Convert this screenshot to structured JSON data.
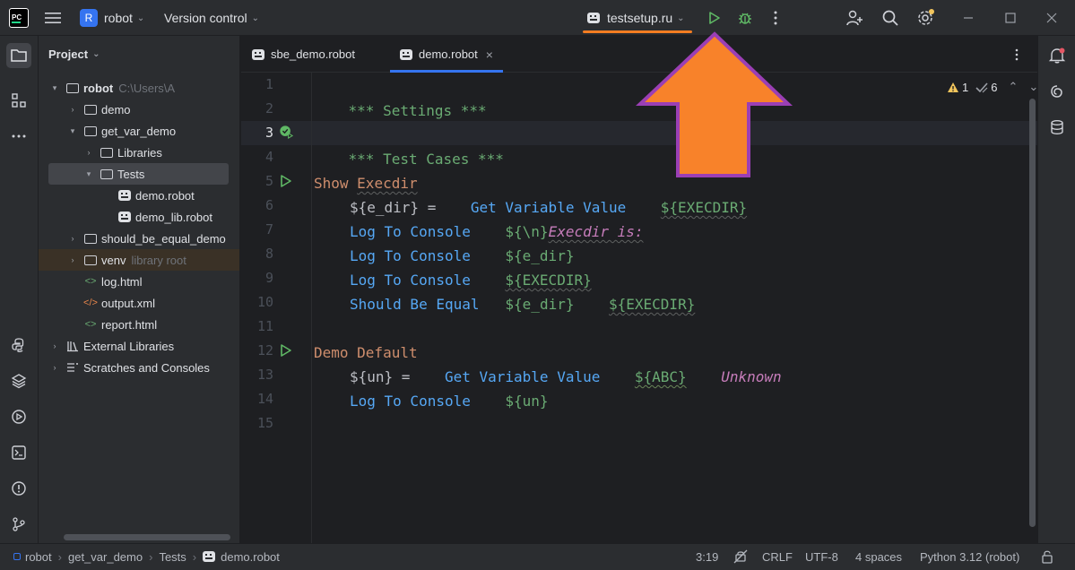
{
  "titlebar": {
    "app_logo": "PC",
    "project_badge": "R",
    "project_name": "robot",
    "vcs_menu": "Version control",
    "run_config": "testsetup.ru",
    "icons": [
      "hamburger-icon",
      "run-icon",
      "debug-icon",
      "more-icon",
      "add-user-icon",
      "search-icon",
      "settings-icon",
      "minimize-icon",
      "maximize-icon",
      "close-icon"
    ]
  },
  "left_toolbar": {
    "icons": [
      "project-folder-icon",
      "structure-icon",
      "more-icon",
      "python-console-icon",
      "layers-icon",
      "services-icon",
      "terminal-icon",
      "problems-icon",
      "git-icon"
    ]
  },
  "project_panel": {
    "title": "Project",
    "tree": [
      {
        "label": "robot",
        "secondary": "C:\\Users\\A"
      },
      {
        "label": "demo"
      },
      {
        "label": "get_var_demo"
      },
      {
        "label": "Libraries"
      },
      {
        "label": "Tests"
      },
      {
        "label": "demo.robot"
      },
      {
        "label": "demo_lib.robot"
      },
      {
        "label": "should_be_equal_demo"
      },
      {
        "label": "venv",
        "secondary": "library root"
      },
      {
        "label": "log.html"
      },
      {
        "label": "output.xml"
      },
      {
        "label": "report.html"
      },
      {
        "label": "External Libraries"
      },
      {
        "label": "Scratches and Consoles"
      }
    ]
  },
  "editor": {
    "tabs": [
      {
        "label": "sbe_demo.robot"
      },
      {
        "label": "demo.robot",
        "close": "×"
      }
    ],
    "warnings": "1",
    "weak_warnings": "6",
    "line_numbers": [
      "1",
      "2",
      "3",
      "4",
      "5",
      "6",
      "7",
      "8",
      "9",
      "10",
      "11",
      "12",
      "13",
      "14",
      "15"
    ],
    "code": {
      "l1": "*** Settings ***",
      "l3": "*** Test Cases ***",
      "l5_name": "Show ",
      "l5_name_b": "Execdir",
      "l6_var": "${e_dir} =",
      "l6_kw": "Get Variable Value",
      "l6_arg": "${EXECDIR}",
      "l7_kw": "Log To Console",
      "l7_arg_a": "${\\n}",
      "l7_arg_b": "Execdir is:",
      "l8_kw": "Log To Console",
      "l8_arg": "${e_dir}",
      "l9_kw": "Log To Console",
      "l9_arg": "${EXECDIR}",
      "l10_kw": "Should Be Equal",
      "l10_arg1": "${e_dir}",
      "l10_arg2": "${EXECDIR}",
      "l12_name": "Demo Default",
      "l13_var": "${un} =",
      "l13_kw": "Get Variable Value",
      "l13_arg1": "${ABC}",
      "l13_arg2": "Unknown",
      "l14_kw": "Log To Console",
      "l14_arg": "${un}"
    }
  },
  "right_toolbar": {
    "icons": [
      "notifications-icon",
      "ai-assistant-icon",
      "database-icon"
    ]
  },
  "statusbar": {
    "breadcrumb": [
      "robot",
      "get_var_demo",
      "Tests",
      "demo.robot"
    ],
    "position": "3:19",
    "line_ending": "CRLF",
    "encoding": "UTF-8",
    "indent": "4 spaces",
    "interpreter": "Python 3.12 (robot)"
  },
  "colors": {
    "accent": "#3574f0",
    "run_green": "#5fb865",
    "highlight_orange": "#f47d22",
    "arrow_fill": "#f8822a",
    "arrow_stroke": "#9b3fb5"
  }
}
